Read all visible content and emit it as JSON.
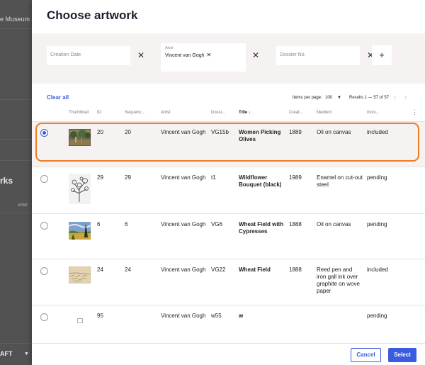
{
  "background": {
    "museum_text": "e Museum of A",
    "works_text": "rks",
    "artist_text": "Artist",
    "status_text": "AFT"
  },
  "modal": {
    "title": "Choose artwork",
    "filters": {
      "creation_date_placeholder": "Creation Date",
      "artist_label": "Artist",
      "artist_chip": "Vincent van Gogh",
      "dossier_placeholder": "Dossier No.",
      "close_glyph": "✕",
      "chip_remove_glyph": "✕",
      "add_glyph": "+"
    },
    "toolbar": {
      "clear_all": "Clear all",
      "items_per_page_label": "Items per page:",
      "items_per_page_value": "100",
      "results": "Results 1 — 57 of 57"
    },
    "columns": {
      "thumbnail": "Thumbnail",
      "id": "ID",
      "sequence": "Sequenc...",
      "artist": "Artist",
      "dossier": "Dossi...",
      "title": "Title ↓",
      "creation": "Creat...",
      "medium": "Medium",
      "inclusion": "Inclu..."
    },
    "rows": [
      {
        "id": "20",
        "sequence": "20",
        "artist": "Vincent van Gogh",
        "dossier": "VG15b",
        "title": "Women Picking Olives",
        "creation": "1889",
        "medium": "Oil on canvas",
        "inclusion": "included",
        "selected": true,
        "thumb": "olives"
      },
      {
        "id": "29",
        "sequence": "29",
        "artist": "Vincent van Gogh",
        "dossier": "t1",
        "title": "Wildflower Bouquet (black)",
        "creation": "1989",
        "medium": "Enamel on cut-out steel",
        "inclusion": "pending",
        "selected": false,
        "thumb": "bouquet"
      },
      {
        "id": "6",
        "sequence": "6",
        "artist": "Vincent van Gogh",
        "dossier": "VG6",
        "title": "Wheat Field with Cypresses",
        "creation": "1888",
        "medium": "Oil on canvas",
        "inclusion": "pending",
        "selected": false,
        "thumb": "cypresses"
      },
      {
        "id": "24",
        "sequence": "24",
        "artist": "Vincent van Gogh",
        "dossier": "VG22",
        "title": "Wheat Field",
        "creation": "1888",
        "medium": "Reed pen and iron gall ink over graphite on wove paper",
        "inclusion": "included",
        "selected": false,
        "thumb": "drawing"
      },
      {
        "id": "95",
        "sequence": "",
        "artist": "Vincent van Gogh",
        "dossier": "w55",
        "title": "w",
        "creation": "",
        "medium": "",
        "inclusion": "pending",
        "selected": false,
        "thumb": "placeholder"
      }
    ],
    "footer": {
      "cancel": "Cancel",
      "select": "Select"
    }
  },
  "colors": {
    "accent": "#3b5ce0",
    "highlight": "#f07a1e",
    "filter_bg": "#f6f2f2"
  }
}
